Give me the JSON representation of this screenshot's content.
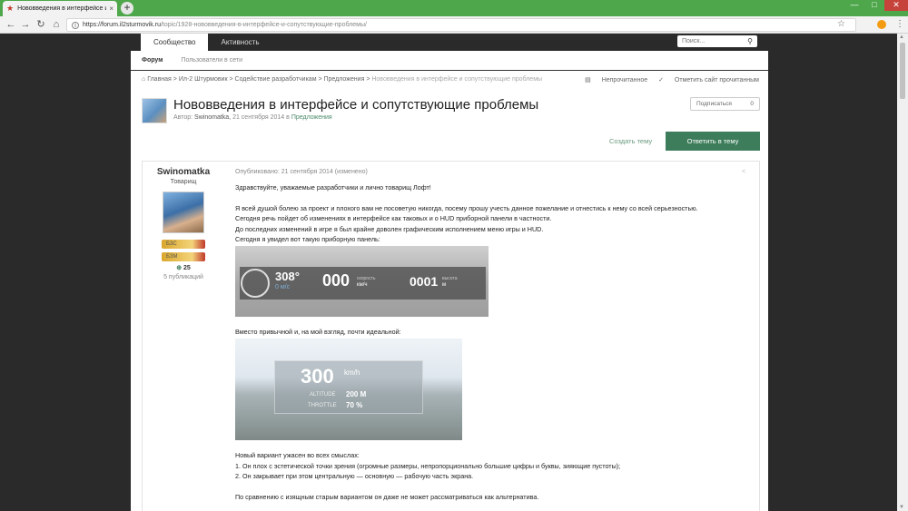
{
  "browser": {
    "tab_title": "Нововведения в интерфейсе и соп",
    "tab_close": "×",
    "new_tab": "+",
    "url_host": "https://forum.il2sturmovik.ru",
    "url_path": "/topic/1928-нововведения-в-интерфейсе-и-сопутствующие-проблемы/",
    "window_min": "—",
    "window_max": "□",
    "window_close": "✕"
  },
  "site": {
    "nav_tabs": [
      "Сообщество",
      "Активность"
    ],
    "search_placeholder": "Поиск...",
    "subnav": [
      "Форум",
      "Пользователи в сети"
    ]
  },
  "breadcrumbs": {
    "items": [
      "Главная",
      "Ил-2 Штурмовик",
      "Содействие разработчикам",
      "Предложения",
      "Нововведения в интерфейсе и сопутствующие проблемы"
    ],
    "unread": "Непрочитанное",
    "mark_read": "Отметить сайт прочитанным"
  },
  "topic": {
    "title": "Нововведения в интерфейсе и сопутствующие проблемы",
    "meta_prefix": "Автор:",
    "author": "Swinomatka,",
    "date": "21 сентября 2014",
    "in": "в",
    "forum": "Предложения",
    "subscribe": "Подписаться",
    "subscribe_count": "0",
    "create_topic": "Создать тему",
    "reply": "Ответить в тему"
  },
  "author_card": {
    "name": "Swinomatka",
    "rank": "Товарищ",
    "badges": [
      "БЗС",
      "БЗМ"
    ],
    "reputation": "25",
    "posts": "5 публикаций"
  },
  "post": {
    "published": "Опубликовано: 21 сентября 2014 (изменено)",
    "paragraphs": [
      "Здравствуйте, уважаемые разработчики и лично товарищ Лофт!",
      "Я всей душой болею за проект и плохого вам не посоветую никогда, посему прошу учесть данное пожелание и отнестись к нему со всей серьезностью.",
      "Сегодня речь пойдет об изменениях в интерфейсе как таковых и о HUD приборной панели в частности.",
      "До последних изменений в игре я был крайне доволен графическим исполнением меню игры и HUD.",
      "Сегодня я увидел вот такую приборную панель:",
      "Вместо привычной и, на мой взгляд, почти идеальной:",
      "Новый вариант ужасен во всех смыслах:",
      "1. Он плох с эстетической точки зрения (огромные размеры, непропорционально большие цифры и буквы, зияющие пустоты);",
      "2. Он закрывает при этом центральную — основную — рабочую часть экрана.",
      "По сравнению с изящным старым вариантом он даже не может рассматриваться как альтернатива."
    ]
  },
  "hud_old": {
    "heading": "308°",
    "vario": "0 м/с",
    "speed": "000",
    "speed_label": "скорость",
    "speed_unit": "км/ч",
    "alt": "0001",
    "alt_label": "высота",
    "alt_unit": "м"
  },
  "hud_new": {
    "speed": "300",
    "speed_unit": "km/h",
    "altitude_label": "ALTITUDE",
    "altitude_value": "200 M",
    "throttle_label": "THROTTLE",
    "throttle_value": "70 %"
  }
}
